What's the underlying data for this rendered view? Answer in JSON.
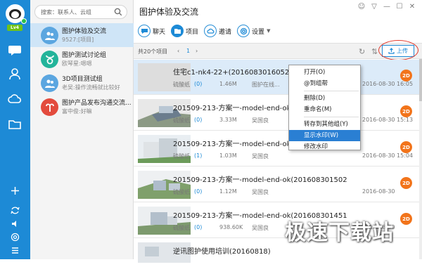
{
  "app": {
    "user_level": "Lv4",
    "colors": {
      "accent": "#1d8ad6",
      "avatar_orange": "#f2741b",
      "highlight": "#2a7fd3",
      "annotation_red": "#e23b2e"
    }
  },
  "search": {
    "placeholder": "搜索：联系人、云组"
  },
  "groups": [
    {
      "name": "图护体验及交流",
      "sub": "9527:[项目]",
      "icon": "group-people-icon"
    },
    {
      "name": "图护测试讨论组",
      "sub": "欧琴星:嗯嗯",
      "icon": "taurus-icon"
    },
    {
      "name": "3D项目测试组",
      "sub": "老吴:操作流畅就比较好",
      "icon": "group-people-icon"
    },
    {
      "name": "图护产品发布沟通交流...",
      "sub": "富中俊:好嘛",
      "icon": "aries-icon"
    }
  ],
  "main": {
    "title": "图护体验及交流",
    "toolbar": {
      "chat": "聊天",
      "project": "项目",
      "invite": "邀请",
      "settings": "设置"
    },
    "count": "共20个项目",
    "page": "1",
    "upload": "上传"
  },
  "rows": [
    {
      "name": "住宅c1-nk4-22+(20160830160524)",
      "paper": "硫酸纸",
      "count": "(0)",
      "size": "1.46M",
      "author": "图护在线...",
      "date": "2016-08-30 16:05",
      "avatar": "2D"
    },
    {
      "name": "201509-213-方案一-model-end-ok",
      "paper": "硫酸纸",
      "count": "(0)",
      "size": "3.33M",
      "author": "吴国良",
      "date": "2016-08-30 15:13",
      "avatar": "2D"
    },
    {
      "name": "201509-213-方案一-model-end-ok",
      "paper": "硫酸纸",
      "count": "(1)",
      "size": "1.03M",
      "author": "吴国良",
      "date": "2016-08-30 15:04",
      "avatar": "2D"
    },
    {
      "name": "201509-213-方案一-model-end-ok(201608301502",
      "paper": "硫酸纸",
      "count": "(0)",
      "size": "1.12M",
      "author": "吴国良",
      "date": "2016-08-30",
      "avatar": "2D"
    },
    {
      "name": "201509-213-方案一-model-end-ok(201608301451",
      "paper": "硫酸纸",
      "count": "(0)",
      "size": "938.60K",
      "author": "吴国良",
      "date": "2016-08-30",
      "avatar": "2D"
    },
    {
      "name": "逆讯图护使用培训(20160818)",
      "paper": "",
      "count": "",
      "size": "",
      "author": "",
      "date": "",
      "avatar": ""
    }
  ],
  "context_menu": [
    {
      "label": "打开(O)",
      "highlight": false,
      "sep_after": false
    },
    {
      "label": "@到组帮",
      "highlight": false,
      "sep_after": true
    },
    {
      "label": "删除(D)",
      "highlight": false,
      "sep_after": false
    },
    {
      "label": "重命名(M)",
      "highlight": false,
      "sep_after": true
    },
    {
      "label": "转存到其他组(Y)",
      "highlight": false,
      "sep_after": false
    },
    {
      "label": "显示水印(W)",
      "highlight": true,
      "sep_after": false
    },
    {
      "label": "修改水印",
      "highlight": false,
      "sep_after": false
    }
  ],
  "watermark": "极速下载站"
}
